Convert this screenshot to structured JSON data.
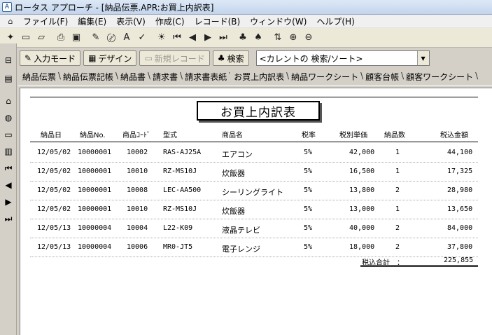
{
  "window": {
    "title": "ロータス アプローチ - [納品伝票.APR:お買上内訳表]"
  },
  "menu": [
    "ファイル(F)",
    "編集(E)",
    "表示(V)",
    "作成(C)",
    "レコード(B)",
    "ウィンドウ(W)",
    "ヘルプ(H)"
  ],
  "toolbar2": {
    "input_mode": "入力モード",
    "design": "デザイン",
    "new_record": "新規レコード",
    "search": "検索",
    "search_combo": "<カレントの 検索/ソート>"
  },
  "tabs": [
    "納品伝票",
    "納品伝票記帳",
    "納品書",
    "請求書",
    "請求書表紙",
    "お買上内訳表",
    "納品ワークシート",
    "顧客台帳",
    "顧客ワークシート"
  ],
  "active_tab": "お買上内訳表",
  "report": {
    "title": "お買上内訳表",
    "headers": [
      "納品日",
      "納品No.",
      "商品ｺｰﾄﾞ",
      "型式",
      "商品名",
      "税率",
      "税別単価",
      "納品数",
      "税込金額"
    ],
    "rows": [
      [
        "12/05/02",
        "10000001",
        "10002",
        "RAS-AJ25A",
        "エアコン",
        "5%",
        "42,000",
        "1",
        "44,100"
      ],
      [
        "12/05/02",
        "10000001",
        "10010",
        "RZ-MS10J",
        "炊飯器",
        "5%",
        "16,500",
        "1",
        "17,325"
      ],
      [
        "12/05/02",
        "10000001",
        "10008",
        "LEC-AA500",
        "シーリングライト",
        "5%",
        "13,800",
        "2",
        "28,980"
      ],
      [
        "12/05/02",
        "10000001",
        "10010",
        "RZ-MS10J",
        "炊飯器",
        "5%",
        "13,000",
        "1",
        "13,650"
      ],
      [
        "12/05/13",
        "10000004",
        "10004",
        "L22-K09",
        "液晶テレビ",
        "5%",
        "40,000",
        "2",
        "84,000"
      ],
      [
        "12/05/13",
        "10000004",
        "10006",
        "MR0-JT5",
        "電子レンジ",
        "5%",
        "18,000",
        "2",
        "37,800"
      ]
    ],
    "total_label": "税込合計　：",
    "total_value": "225,855"
  }
}
